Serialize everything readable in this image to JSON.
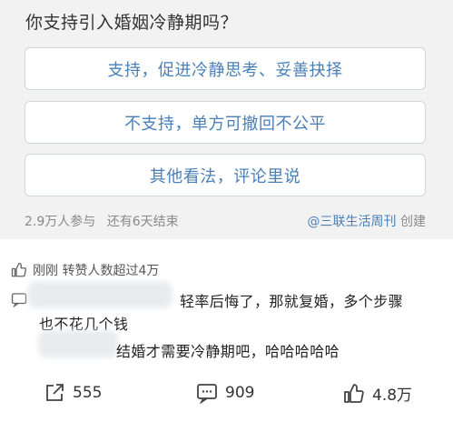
{
  "poll": {
    "question": "你支持引入婚姻冷静期吗？",
    "options": [
      {
        "label": "支持，促进冷静思考、妥善抉择"
      },
      {
        "label": "不支持，单方可撤回不公平"
      },
      {
        "label": "其他看法，评论里说"
      }
    ],
    "participants": "2.9万人参与",
    "time_left": "还有6天结束",
    "creator": "@三联生活周刊",
    "created_label": "创建"
  },
  "notice": {
    "text": "刚刚 转赞人数超过4万"
  },
  "comments": [
    {
      "text_line1": "轻率后悔了，那就复婚，多个步骤",
      "text_line2": "也不花几个钱"
    },
    {
      "text_line1": "结婚才需要冷静期吧，哈哈哈哈哈"
    }
  ],
  "actions": {
    "share_count": "555",
    "comment_count": "909",
    "like_count": "4.8万"
  }
}
